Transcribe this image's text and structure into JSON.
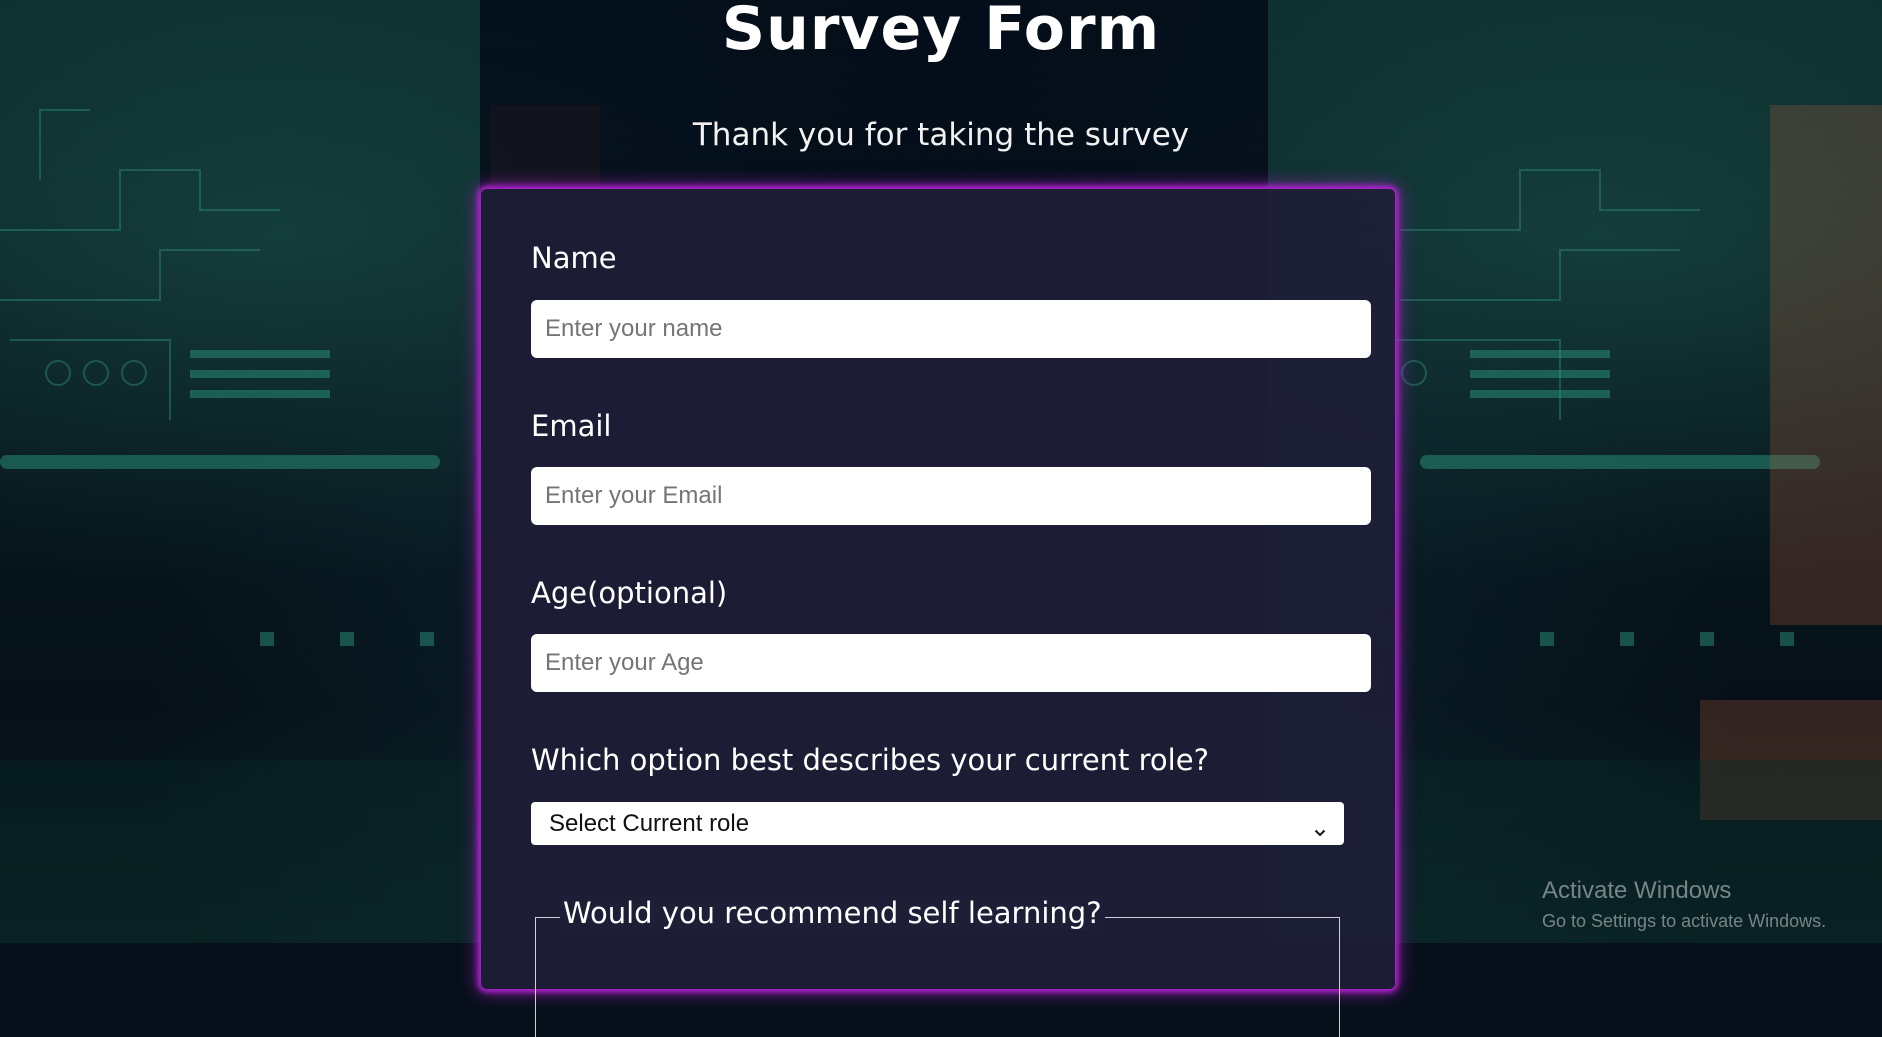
{
  "page": {
    "title": "Survey Form",
    "description": "Thank you for taking the survey"
  },
  "form": {
    "name": {
      "label": "Name",
      "value": "",
      "placeholder": "Enter your name"
    },
    "email": {
      "label": "Email",
      "value": "",
      "placeholder": "Enter your Email"
    },
    "age": {
      "label": "Age(optional)",
      "value": "",
      "placeholder": "Enter your Age"
    },
    "role": {
      "label": "Which option best describes your current role?",
      "selected": "Select Current role",
      "icon": "chevron-down-icon"
    },
    "recommend": {
      "legend": "Would you recommend self learning?"
    }
  },
  "os_watermark": {
    "title": "Activate Windows",
    "subtitle": "Go to Settings to activate Windows."
  },
  "colors": {
    "card_glow": "#b623d6",
    "card_background": "#1e1e37",
    "text": "#ffffff"
  }
}
